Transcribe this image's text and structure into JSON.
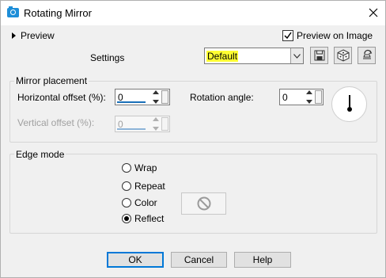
{
  "window": {
    "title": "Rotating Mirror"
  },
  "preview": {
    "expander_label": "Preview",
    "preview_on_image_label": "Preview on Image",
    "preview_on_image_checked": true
  },
  "settings": {
    "label": "Settings",
    "preset_value": "Default"
  },
  "mirror_placement": {
    "title": "Mirror placement",
    "horizontal_offset_label": "Horizontal offset (%):",
    "horizontal_offset_value": "0",
    "vertical_offset_label": "Vertical offset (%):",
    "vertical_offset_value": "0",
    "rotation_angle_label": "Rotation angle:",
    "rotation_angle_value": "0"
  },
  "edge_mode": {
    "title": "Edge mode",
    "options": [
      {
        "label": "Wrap",
        "selected": false
      },
      {
        "label": "Repeat",
        "selected": false
      },
      {
        "label": "Color",
        "selected": false
      },
      {
        "label": "Reflect",
        "selected": true
      }
    ]
  },
  "buttons": {
    "ok": "OK",
    "cancel": "Cancel",
    "help": "Help"
  },
  "colors": {
    "accent": "#0078d7",
    "highlight": "#ffff33",
    "icon_blue": "#1e8ed8"
  }
}
